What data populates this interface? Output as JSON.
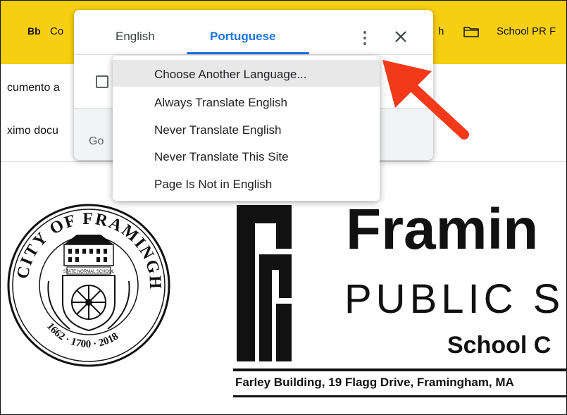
{
  "bookmarks": {
    "items": [
      "Bb",
      "Co",
      "h",
      "School PR F"
    ]
  },
  "page": {
    "line1": "cumento a",
    "line2": "ximo docu"
  },
  "translate_popup": {
    "tabs": [
      "English",
      "Portuguese"
    ],
    "footer_text": "Go"
  },
  "menu": {
    "items": [
      "Choose Another Language...",
      "Always Translate English",
      "Never Translate English",
      "Never Translate This Site",
      "Page Is Not in English"
    ]
  },
  "logo": {
    "seal_top": "CITY OF FRAMINGHAM",
    "seal_years": "1662 · 1700 · 2018",
    "seal_banner": "STATE NORMAL SCHOOL",
    "title": "Framin",
    "subtitle": "PUBLIC S",
    "school_line": "School C",
    "address": "Farley Building, 19 Flagg Drive, Framingham, MA"
  },
  "colors": {
    "bookmark_bar": "#f7cf11",
    "accent": "#1a73e8",
    "arrow": "#f23a1b"
  }
}
